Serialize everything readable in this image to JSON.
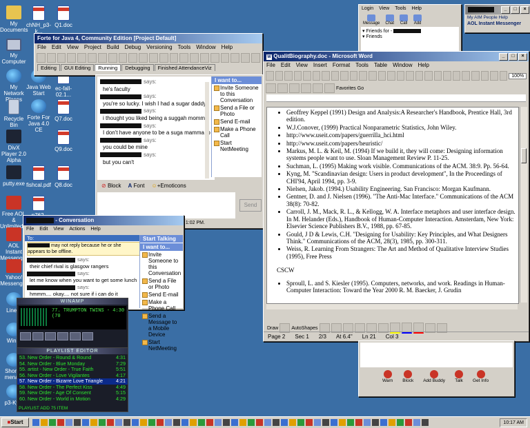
{
  "desktop": {
    "icons": [
      {
        "label": "My Documents",
        "icon": "folder-icon"
      },
      {
        "label": "chNH_p3-k...",
        "icon": "document-icon"
      },
      {
        "label": "Q1.doc",
        "icon": "document-icon"
      },
      {
        "label": "My Computer",
        "icon": "computer-icon"
      },
      {
        "label": "My Network Places",
        "icon": "network-icon"
      },
      {
        "label": "Java Web Start",
        "icon": "java-icon"
      },
      {
        "label": "ec-fall-02.1...",
        "icon": "document-icon"
      },
      {
        "label": "Recycle Bin",
        "icon": "recycle-bin-icon"
      },
      {
        "label": "Forte For Java 4.0 CE",
        "icon": "forte-icon"
      },
      {
        "label": "Q7.doc",
        "icon": "document-icon"
      },
      {
        "label": "DivX Player 2.0 Alpha",
        "icon": "divx-icon"
      },
      {
        "label": "Q9.doc",
        "icon": "document-icon"
      },
      {
        "label": "putty.exe",
        "icon": "putty-icon"
      },
      {
        "label": "fishcal.pdf",
        "icon": "pdf-icon"
      },
      {
        "label": "Q8.doc",
        "icon": "document-icon"
      },
      {
        "label": "Free AOL & Unlimited...",
        "icon": "aol-icon"
      },
      {
        "label": "p762-grudi...",
        "icon": "pdf-icon"
      },
      {
        "label": "AOL Instant Messenger",
        "icon": "aim-icon"
      },
      {
        "label": "Yahoo! Messenger",
        "icon": "yahoo-icon"
      },
      {
        "label": "Line...",
        "icon": "shortcut-icon"
      },
      {
        "label": "Win...",
        "icon": "shortcut-icon"
      },
      {
        "label": "Short... mena...",
        "icon": "shortcut-icon"
      },
      {
        "label": "p3-Ky...",
        "icon": "shortcut-icon"
      }
    ]
  },
  "forte": {
    "title": "Forte for Java 4, Community Edition [Project Default]",
    "menu": [
      "File",
      "Edit",
      "View",
      "Project",
      "Build",
      "Debug",
      "Versioning",
      "Tools",
      "Window",
      "Help"
    ],
    "tabs": [
      "Editing",
      "GUI Editing",
      "Running",
      "Debugging",
      "Finished AttendanceViz"
    ]
  },
  "chat1": {
    "lines": [
      {
        "kind": "says",
        "text": "says:"
      },
      {
        "kind": "msg",
        "text": "he's faculty"
      },
      {
        "kind": "says",
        "text": "says:"
      },
      {
        "kind": "msg",
        "text": "you're so lucky.  I wish I had a sugar daddy"
      },
      {
        "kind": "says",
        "text": "says:"
      },
      {
        "kind": "msg",
        "text": "i thought you liked being a suggah momma"
      },
      {
        "kind": "says",
        "text": "says:"
      },
      {
        "kind": "msg",
        "text": "I don't have anyone to be a suga mamma to"
      },
      {
        "kind": "says",
        "text": "says:"
      },
      {
        "kind": "msg",
        "text": "you could be mine"
      },
      {
        "kind": "says",
        "text": "says:"
      },
      {
        "kind": "msg",
        "text": "but you can't"
      }
    ],
    "panel_header": "I want to...",
    "panel_items": [
      "Invite Someone to this Conversation",
      "Send a File or Photo",
      "Send E-mail",
      "Make a Phone Call",
      "Start NetMeeting"
    ],
    "bottom": {
      "block": "Block",
      "font": "Font",
      "emoticons": "+Emoticons",
      "send": "Send"
    },
    "status": "Last message received on 11/13/2002 at 1:02 PM."
  },
  "chat2": {
    "title": "- Conversation",
    "menu": [
      "File",
      "Edit",
      "View",
      "Actions",
      "Help"
    ],
    "to_label": "To:",
    "warning": "may not reply because he or she appears to be offline.",
    "lines": [
      {
        "kind": "says",
        "text": "says:"
      },
      {
        "kind": "msg",
        "text": "their chief rival is glasgow rangers"
      },
      {
        "kind": "says",
        "text": "says:"
      },
      {
        "kind": "msg",
        "text": "let me know when you want to get some lunch"
      },
      {
        "kind": "says",
        "text": "says:"
      },
      {
        "kind": "msg",
        "text": "hmmm.... okay.... not sure if i can do it"
      }
    ],
    "panel_header1": "Start Talking",
    "panel_header2": "I want to...",
    "panel_items": [
      "Invite Someone to this Conversation",
      "Send a File or Photo",
      "Send E-mail",
      "Make a Phone Call",
      "Send a Message to a Mobile Device",
      "Start NetMeeting"
    ]
  },
  "winamp": {
    "title": "WINAMP",
    "display": "77. TRUMPTON TWINS - 4:30 (70",
    "playlist_title": "PLAYLIST EDITOR",
    "playlist": [
      {
        "name": "53. New Order - Round & Round",
        "time": "4:31"
      },
      {
        "name": "54. New Order - Blue Monday",
        "time": "7:29"
      },
      {
        "name": "55. artist - New Order - True Faith",
        "time": "5:51"
      },
      {
        "name": "56. New Order - Love Vigilantes",
        "time": "4:17"
      },
      {
        "name": "57. New Order - Bizarre Love Triangle",
        "time": "4:21"
      },
      {
        "name": "58. New Order - The Perfect Kiss",
        "time": "4:49"
      },
      {
        "name": "59. New Order - Age Of Consent",
        "time": "5:15"
      },
      {
        "name": "60. New Order - World in Motion",
        "time": "4:29"
      }
    ],
    "playlist_footer": "PLAYLIST  ADD  75 ITEM"
  },
  "aim": {
    "menu": [
      "Login",
      "View",
      "Tools",
      "Help"
    ],
    "buttons": [
      "Message",
      "Chat",
      "Call",
      "Add"
    ],
    "groups": [
      "Friends for -",
      "Friends"
    ],
    "side_links": "My AIM  People  Help",
    "brand": "AOL Instant Messenger"
  },
  "word": {
    "title": "QualitBiography.doc - Microsoft Word",
    "menu": [
      "File",
      "Edit",
      "View",
      "Insert",
      "Format",
      "Tools",
      "Table",
      "Window",
      "Help"
    ],
    "zoom": "100%",
    "favorites": "Favorites",
    "go": "Go",
    "entries": [
      "Geoffrey Keppel (1991) Design and Analysis:A Researcher's Handbook, Prentice Hall, 3rd edition.",
      "W.J.Conover, (1999) Practical Nonparametric Statistics, John Wiley.",
      "http://www.useit.com/papers/guerrilla_hci.html",
      "http://www.useit.com/papers/heuristic/",
      "Markus, M. L. & Keil, M. (1994) If we build it, they will come: Designing information systems people want to use. Sloan Management Review P. 11-25.",
      "Suchman, L. (1995) Making work visible. Communications of the ACM. 38:9. Pp. 56-64.",
      "Kyng, M. \"Scandinavian design: Users in product development\", In the Proceedings of CHI'94, April 1994, pp. 3-9.",
      "Nielsen, Jakob. (1994.) Usability Engineering. San Francisco: Morgan Kaufmann.",
      "Gentner, D. and J. Nielsen (1996). \"The Anti-Mac Interface.\" Communications of the ACM 38(8): 70-82.",
      "Carroll, J. M., Mack, R. L., & Kellogg, W. A. Interface metaphors and user interface design. In M. Helander (Eds.), Handbook of Human-Computer Interaction. Amsterdam, New York: Elsevier Science Publishers B.V., 1988, pp. 67-85.",
      "Gould, J D & Lewis, C.H. \"Designing for Usability: Key Principles, and What Designers Think.\" Communications of the ACM, 28(3), 1985, pp. 300-311.",
      "Weiss, R. Learning From Strangers: The Art and Method of Qualitative Interview Studies (1995), Free Press"
    ],
    "heading": "CSCW",
    "entries2": [
      "Sproull, L. and S. Kiesler (1995). Computers, networks, and work. Readings in Human-Computer Interaction: Toward the Year 2000 R. M. Baecker, J. Grudin"
    ],
    "drawbar": {
      "draw": "Draw",
      "autoshapes": "AutoShapes"
    },
    "status": {
      "page": "Page 2",
      "sec": "Sec 1",
      "pos": "2/3",
      "at": "At 6.4\"",
      "ln": "Ln 21",
      "col": "Col 3"
    }
  },
  "msn_bottom": {
    "buttons": [
      "Warn",
      "Block",
      "Add Buddy",
      "Talk",
      "Get Info"
    ]
  },
  "taskbar": {
    "start": "Start",
    "clock": "10:17 AM"
  }
}
